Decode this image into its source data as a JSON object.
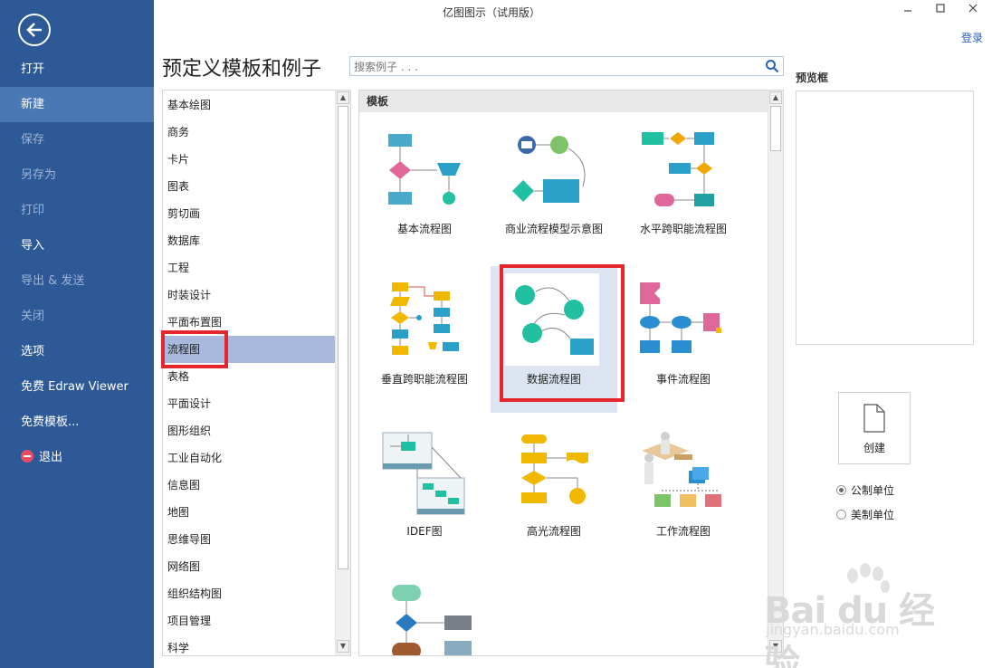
{
  "window": {
    "title": "亿图图示（试用版）",
    "login": "登录"
  },
  "sidebar": {
    "items": [
      {
        "label": "打开"
      },
      {
        "label": "新建"
      },
      {
        "label": "保存"
      },
      {
        "label": "另存为"
      },
      {
        "label": "打印"
      },
      {
        "label": "导入"
      },
      {
        "label": "导出 & 发送"
      },
      {
        "label": "关闭"
      },
      {
        "label": "选项"
      },
      {
        "label": "免费 Edraw Viewer"
      },
      {
        "label": "免费模板..."
      },
      {
        "label": "退出"
      }
    ],
    "active": "新建"
  },
  "main": {
    "heading": "预定义模板和例子",
    "search_placeholder": "搜索例子 . . ."
  },
  "categories": {
    "items": [
      "基本绘图",
      "商务",
      "卡片",
      "图表",
      "剪切画",
      "数据库",
      "工程",
      "时装设计",
      "平面布置图",
      "流程图",
      "表格",
      "平面设计",
      "图形组织",
      "工业自动化",
      "信息图",
      "地图",
      "思维导图",
      "网络图",
      "组织结构图",
      "项目管理",
      "科学"
    ],
    "selected": "流程图"
  },
  "templates": {
    "section_label": "模板",
    "items": [
      {
        "label": "基本流程图"
      },
      {
        "label": "商业流程模型示意图"
      },
      {
        "label": "水平跨职能流程图"
      },
      {
        "label": "垂直跨职能流程图"
      },
      {
        "label": "数据流程图"
      },
      {
        "label": "事件流程图"
      },
      {
        "label": "IDEF图"
      },
      {
        "label": "高光流程图"
      },
      {
        "label": "工作流程图"
      }
    ],
    "selected": "数据流程图"
  },
  "preview": {
    "label": "预览框",
    "create_label": "创建",
    "units": [
      {
        "label": "公制单位",
        "checked": true
      },
      {
        "label": "美制单位",
        "checked": false
      }
    ]
  },
  "watermark": {
    "brand": "Bai du 经验",
    "url": "jingyan.baidu.com"
  },
  "colors": {
    "sidebar": "#2d5a96",
    "sidebar_active": "#4a78b5",
    "selection": "#a9b9dd",
    "highlight": "#e5262c"
  }
}
